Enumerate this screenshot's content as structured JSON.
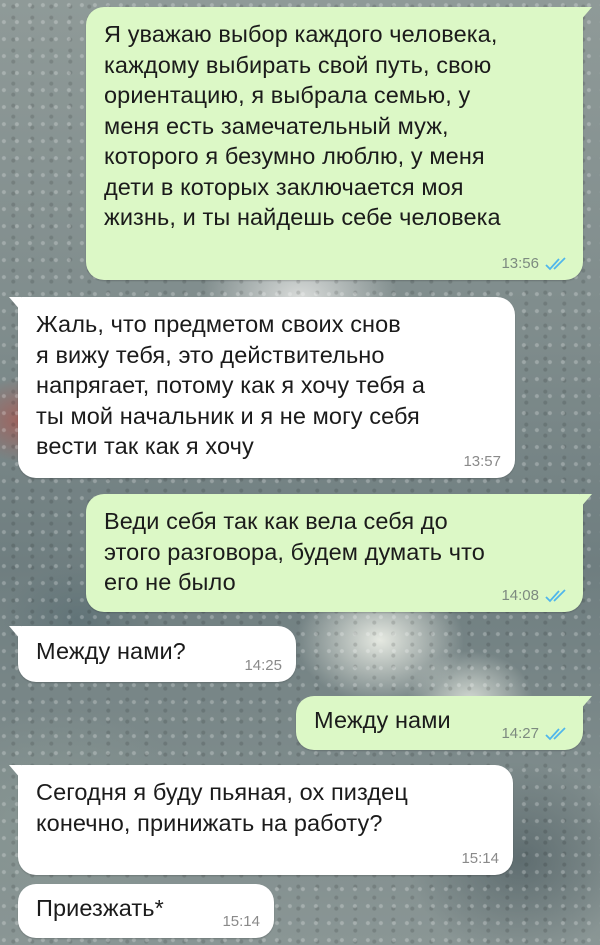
{
  "chat": {
    "messages": [
      {
        "direction": "outgoing",
        "text": "Я уважаю выбор каждого человека,\nкаждому выбирать свой путь, свою\nориентацию, я выбрала семью, у\nменя есть замечательный муж,\nкоторого я безумно люблю, у меня\nдети в которых заключается моя\nжизнь, и ты найдешь себе человека",
        "time": "13:56",
        "status": "read-double-check-icon"
      },
      {
        "direction": "incoming",
        "text": "Жаль, что предметом своих снов\nя вижу тебя, это действительно\nнапрягает, потому как я хочу тебя а\nты мой начальник и я не могу себя\nвести так как я хочу",
        "time": "13:57"
      },
      {
        "direction": "outgoing",
        "text": "Веди себя так как вела себя до\nэтого разговора, будем думать что\nего не было",
        "time": "14:08",
        "status": "read-double-check-icon"
      },
      {
        "direction": "incoming",
        "text": "Между нами?",
        "time": "14:25"
      },
      {
        "direction": "outgoing",
        "text": "Между нами",
        "time": "14:27",
        "status": "read-double-check-icon"
      },
      {
        "direction": "incoming",
        "text": "Сегодня я буду пьяная, ох пиздец\nконечно, принижать на работу?",
        "time": "15:14"
      },
      {
        "direction": "incoming",
        "text": "Приезжать*",
        "time": "15:14"
      }
    ]
  },
  "colors": {
    "outgoing_bubble": "#dcf8c6",
    "incoming_bubble": "#ffffff",
    "read_ticks": "#4fb6ec"
  }
}
